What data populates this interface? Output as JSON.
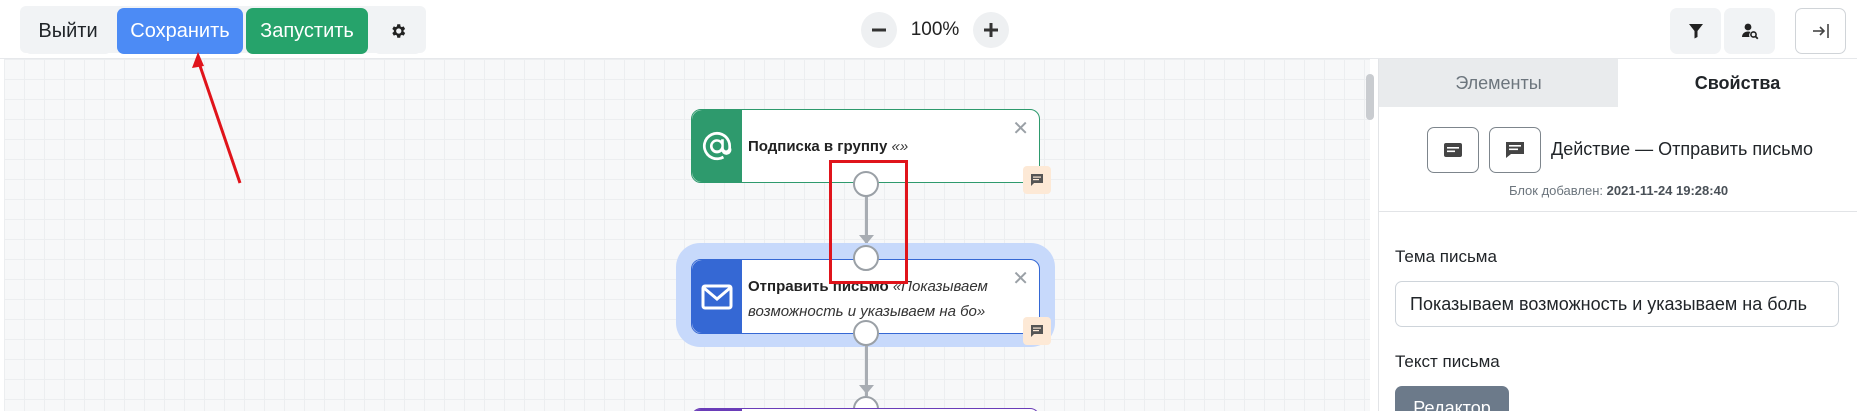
{
  "toolbar": {
    "exit_label": "Выйти",
    "save_label": "Сохранить",
    "run_label": "Запустить",
    "zoom_value": "100%",
    "icons": [
      "gear-icon",
      "minus-icon",
      "plus-icon",
      "filter-icon",
      "user-search-icon",
      "exit-panel-icon"
    ]
  },
  "canvas": {
    "nodes": [
      {
        "title_bold": "Подписка в группу",
        "title_italic": "«»",
        "color": "#2e9a6d",
        "icon": "at-sign-icon"
      },
      {
        "title_bold": "Отправить письмо",
        "title_italic": "«Показываем возможность и указываем на бо»",
        "color": "#3568d4",
        "icon": "envelope-icon",
        "selected": true
      }
    ]
  },
  "panel": {
    "tabs": [
      {
        "label": "Элементы",
        "active": false
      },
      {
        "label": "Свойства",
        "active": true
      }
    ],
    "action_title": "Действие — Отправить письмо",
    "added_label": "Блок добавлен:",
    "added_value": "2021-11-24 19:28:40",
    "subject_label": "Тема письма",
    "subject_value": "Показываем возможность и указываем на боль",
    "text_label": "Текст письма",
    "editor_label": "Редактор"
  },
  "colors": {
    "primary": "#4c8bf5",
    "success": "#26a36b",
    "annotation": "#e0141b"
  }
}
